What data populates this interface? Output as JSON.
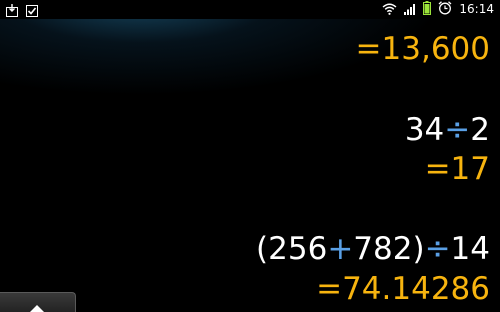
{
  "status_bar": {
    "left_icons": [
      "download-icon",
      "task-check-icon"
    ],
    "right_icons": [
      "wifi-icon",
      "signal-icon",
      "battery-icon",
      "alarm-icon"
    ],
    "time": "16:14"
  },
  "history": {
    "top_result": "=13,600",
    "entries": [
      {
        "expression_parts": [
          {
            "text": "34",
            "type": "num"
          },
          {
            "text": "÷",
            "type": "op"
          },
          {
            "text": "2",
            "type": "num"
          }
        ],
        "result": "=17"
      },
      {
        "expression_parts": [
          {
            "text": "(256",
            "type": "num"
          },
          {
            "text": "+",
            "type": "op"
          },
          {
            "text": "782)",
            "type": "num"
          },
          {
            "text": "÷",
            "type": "op"
          },
          {
            "text": "14",
            "type": "num"
          }
        ],
        "result": "=74.14286"
      }
    ]
  },
  "keypad_toggle": {
    "icon": "chevron-up-icon"
  },
  "colors": {
    "result": "#f7b40f",
    "operator": "#5aa0e6",
    "expression": "#ffffff",
    "background": "#000000"
  }
}
